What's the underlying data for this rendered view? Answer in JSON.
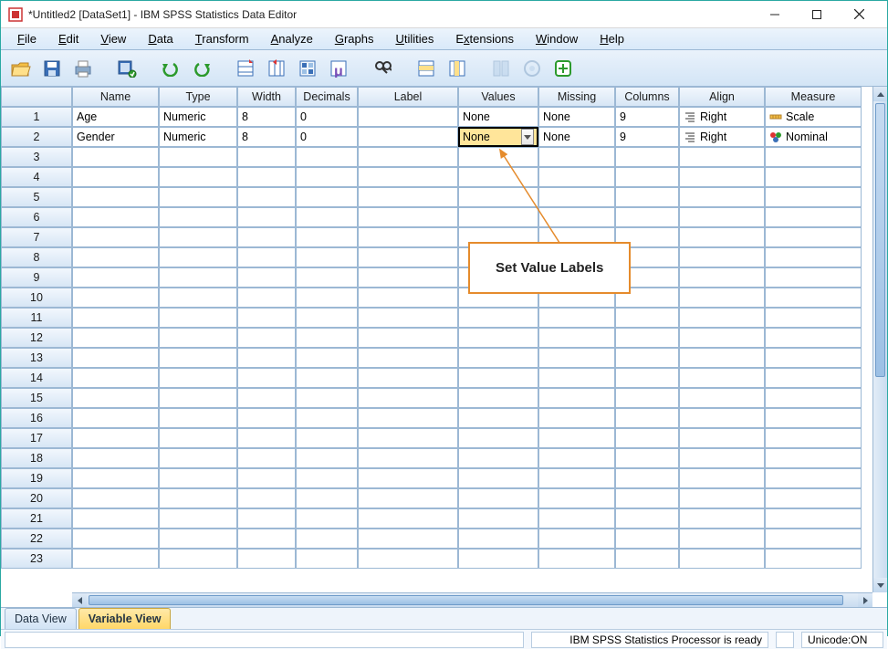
{
  "title": "*Untitled2 [DataSet1] - IBM SPSS Statistics Data Editor",
  "menus": [
    "File",
    "Edit",
    "View",
    "Data",
    "Transform",
    "Analyze",
    "Graphs",
    "Utilities",
    "Extensions",
    "Window",
    "Help"
  ],
  "menu_accel": [
    "F",
    "E",
    "V",
    "D",
    "T",
    "A",
    "G",
    "U",
    "x",
    "W",
    "H"
  ],
  "columns": [
    "Name",
    "Type",
    "Width",
    "Decimals",
    "Label",
    "Values",
    "Missing",
    "Columns",
    "Align",
    "Measure"
  ],
  "rows": [
    {
      "name": "Age",
      "type": "Numeric",
      "width": "8",
      "decimals": "0",
      "label": "",
      "values": "None",
      "missing": "None",
      "columns": "9",
      "align": "Right",
      "measure": "Scale"
    },
    {
      "name": "Gender",
      "type": "Numeric",
      "width": "8",
      "decimals": "0",
      "label": "",
      "values": "None",
      "missing": "None",
      "columns": "9",
      "align": "Right",
      "measure": "Nominal"
    }
  ],
  "empty_row_count": 21,
  "tabs": {
    "data_view": "Data View",
    "variable_view": "Variable View"
  },
  "status": {
    "processor": "IBM SPSS Statistics Processor is ready",
    "unicode": "Unicode:ON"
  },
  "callout": "Set Value Labels",
  "icons": {
    "align_right": "align-right-icon",
    "scale": "ruler-icon",
    "nominal": "nominal-icon"
  }
}
